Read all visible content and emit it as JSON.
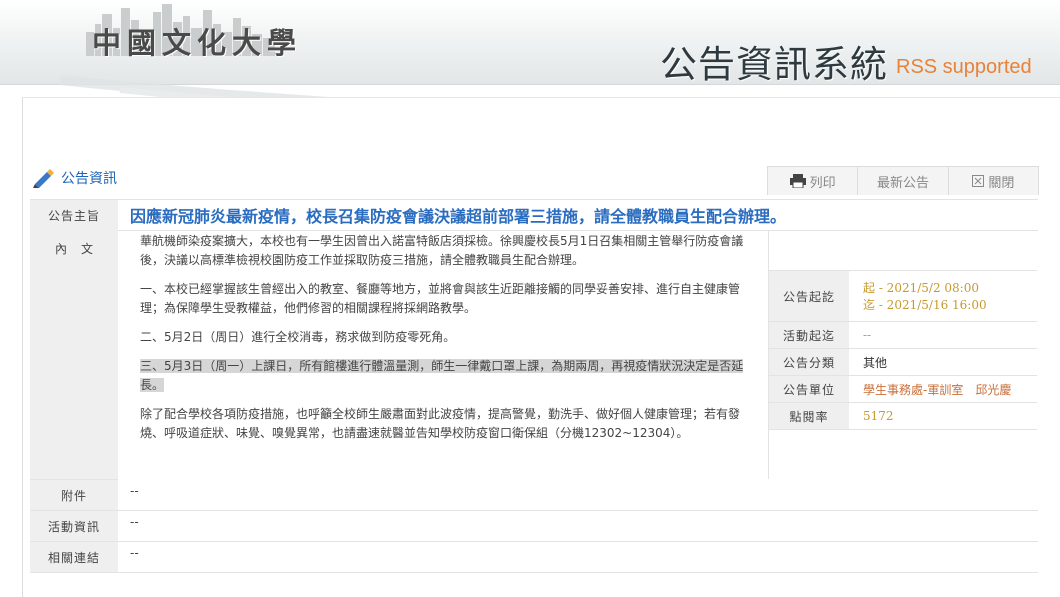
{
  "header": {
    "school_name": "中國文化大學",
    "system_title": "公告資訊系統",
    "rss": "RSS supported"
  },
  "section": {
    "label": "公告資訊",
    "icon": "pencil-icon"
  },
  "actions": [
    {
      "label": "列印",
      "icon": "print-icon"
    },
    {
      "label": "最新公告"
    },
    {
      "label": "關閉",
      "icon": "close-box-icon"
    }
  ],
  "topic": {
    "label": "公告主旨",
    "text": "因應新冠肺炎最新疫情，校長召集防疫會議決議超前部署三措施，請全體教職員生配合辦理。"
  },
  "content": {
    "label": "內文",
    "paragraphs": [
      "華航機師染疫案擴大，本校也有一學生因曾出入諾富特飯店須採檢。徐興慶校長5月1日召集相關主管舉行防疫會議後，決議以高標準檢視校園防疫工作並採取防疫三措施，請全體教職員生配合辦理。",
      "一、本校已經掌握該生曾經出入的教室、餐廳等地方，並將會與該生近距離接觸的同學妥善安排、進行自主健康管理；為保障學生受教權益，他們修習的相關課程將採網路教學。",
      "二、5月2日（周日）進行全校消毒，務求做到防疫零死角。",
      "三、5月3日（周一）上課日，所有館樓進行體溫量測，師生一律戴口罩上課，為期兩周，再視疫情狀況決定是否延長。",
      "除了配合學校各項防疫措施，也呼籲全校師生嚴肅面對此波疫情，提高警覺，勤洗手、做好個人健康管理；若有發燒、呼吸道症狀、味覺、嗅覺異常，也請盡速就醫並告知學校防疫窗口衛保組（分機12302~12304）。"
    ]
  },
  "meta": {
    "period_label": "公告起訖",
    "period_start": "起 - 2021/5/2 08:00",
    "period_end": "迄 - 2021/5/16 16:00",
    "activity_label": "活動起迄",
    "activity_value": "--",
    "category_label": "公告分類",
    "category_value": "其他",
    "unit_label": "公告單位",
    "unit_value": "學生事務處-軍訓室　邱光慶",
    "views_label": "點閱率",
    "views_value": "5172"
  },
  "attachments": {
    "label": "附件",
    "value": "--"
  },
  "activity_info": {
    "label": "活動資訊",
    "value": "--"
  },
  "related_links": {
    "label": "相關連結",
    "value": "--"
  }
}
